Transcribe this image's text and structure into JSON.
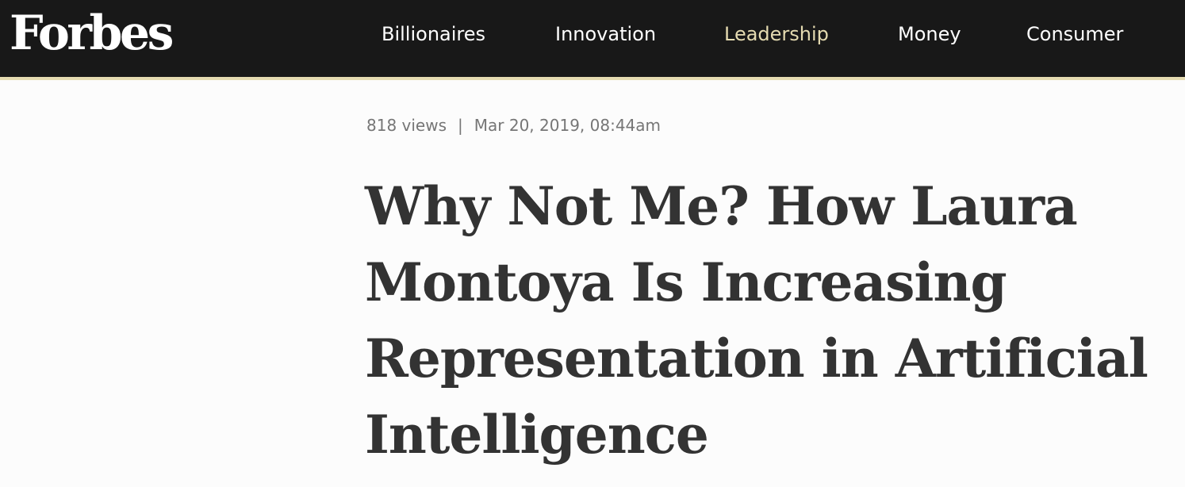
{
  "header": {
    "logo_text": "Forbes",
    "nav": [
      {
        "label": "Billionaires"
      },
      {
        "label": "Innovation"
      },
      {
        "label": "Leadership",
        "active": true
      },
      {
        "label": "Money"
      },
      {
        "label": "Consumer"
      }
    ],
    "colors": {
      "bar_background": "#181818",
      "accent": "#e5dbb1"
    }
  },
  "article": {
    "views": "818 views",
    "separator": "|",
    "date": "Mar 20, 2019, 08:44am",
    "title": "Why Not Me? How Laura Montoya Is Increasing Representation in Artificial Intelligence"
  }
}
